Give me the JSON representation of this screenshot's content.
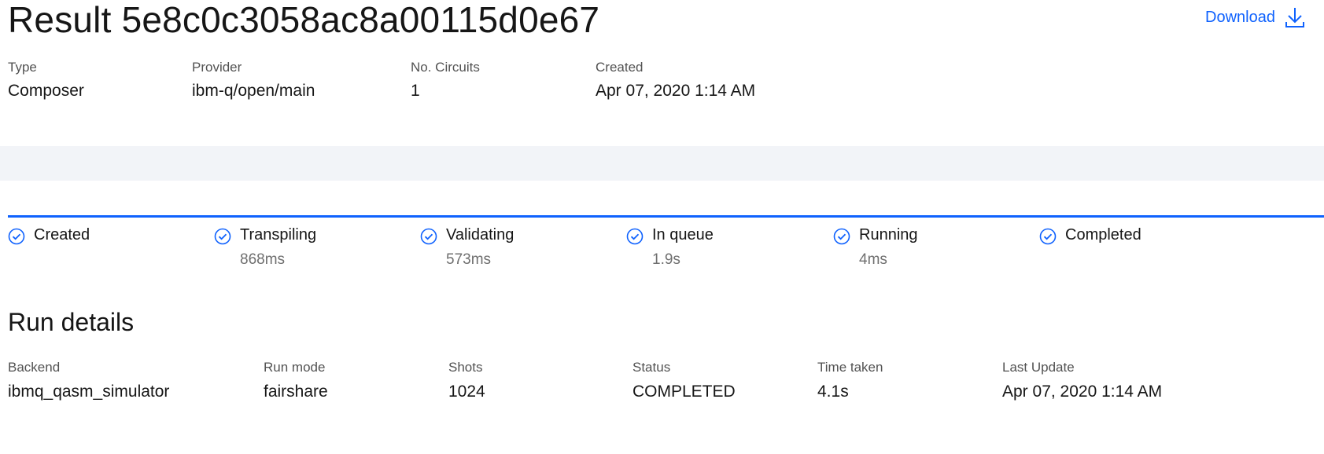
{
  "header": {
    "title": "Result 5e8c0c3058ac8a00115d0e67",
    "download_label": "Download",
    "accent": "#0f62fe"
  },
  "meta": [
    {
      "label": "Type",
      "value": "Composer"
    },
    {
      "label": "Provider",
      "value": "ibm-q/open/main"
    },
    {
      "label": "No. Circuits",
      "value": "1"
    },
    {
      "label": "Created",
      "value": "Apr 07, 2020 1:14 AM"
    }
  ],
  "steps": [
    {
      "label": "Created",
      "time": "",
      "icon": "check-circle-icon"
    },
    {
      "label": "Transpiling",
      "time": "868ms",
      "icon": "check-circle-icon"
    },
    {
      "label": "Validating",
      "time": "573ms",
      "icon": "check-circle-icon"
    },
    {
      "label": "In queue",
      "time": "1.9s",
      "icon": "check-circle-icon"
    },
    {
      "label": "Running",
      "time": "4ms",
      "icon": "check-circle-icon"
    },
    {
      "label": "Completed",
      "time": "",
      "icon": "check-circle-icon"
    }
  ],
  "run_details": {
    "title": "Run details",
    "items": [
      {
        "label": "Backend",
        "value": "ibmq_qasm_simulator"
      },
      {
        "label": "Run mode",
        "value": "fairshare"
      },
      {
        "label": "Shots",
        "value": "1024"
      },
      {
        "label": "Status",
        "value": "COMPLETED"
      },
      {
        "label": "Time taken",
        "value": "4.1s"
      },
      {
        "label": "Last Update",
        "value": "Apr 07, 2020 1:14 AM"
      }
    ]
  }
}
